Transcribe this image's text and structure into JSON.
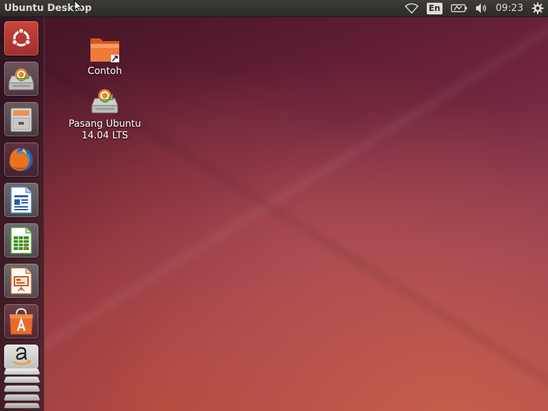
{
  "panel": {
    "title": "Ubuntu Desktop",
    "language": "En",
    "clock": "09:23"
  },
  "launcher": {
    "items": [
      {
        "name": "dash-home",
        "icon": "ubuntu-logo-icon"
      },
      {
        "name": "install-ubuntu",
        "icon": "installer-icon"
      },
      {
        "name": "files",
        "icon": "file-cabinet-icon"
      },
      {
        "name": "firefox",
        "icon": "firefox-icon"
      },
      {
        "name": "libreoffice-writer",
        "icon": "writer-icon"
      },
      {
        "name": "libreoffice-calc",
        "icon": "calc-icon"
      },
      {
        "name": "libreoffice-impress",
        "icon": "impress-icon"
      },
      {
        "name": "software-center",
        "icon": "shopping-bag-icon"
      },
      {
        "name": "amazon",
        "icon": "amazon-icon"
      }
    ]
  },
  "desktop": {
    "icons": [
      {
        "label": "Contoh",
        "icon": "folder-link-icon"
      },
      {
        "label": "Pasang Ubuntu\n14.04 LTS",
        "icon": "installer-icon"
      }
    ]
  },
  "colors": {
    "panel_bg": "#2c2b28",
    "panel_text": "#dfdbd2",
    "ubuntu_orange": "#dd4814",
    "wallpaper_base": "#5a1e37"
  }
}
